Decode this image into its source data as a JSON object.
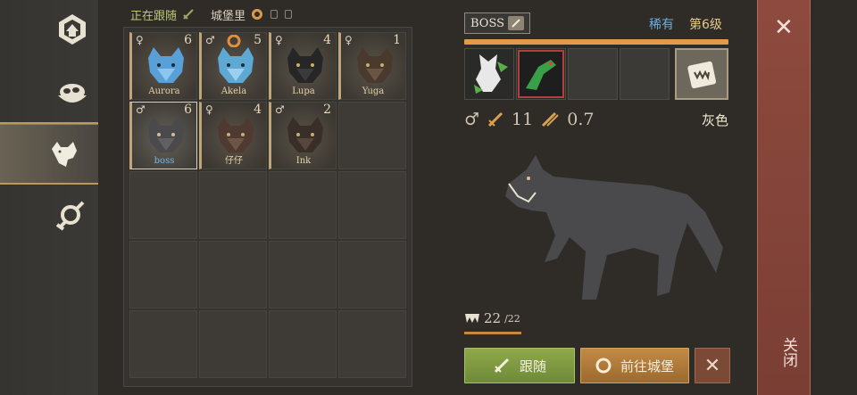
{
  "topbar": {
    "status": "正在跟随",
    "location": "城堡里"
  },
  "wolves": [
    {
      "name": "Aurora",
      "gender": "♀",
      "level": "6",
      "tint": "#5aa0d8"
    },
    {
      "name": "Akela",
      "gender": "♂",
      "level": "5",
      "tint": "#5aa0d8"
    },
    {
      "name": "Lupa",
      "gender": "♀",
      "level": "4",
      "tint": "#2a2a2a"
    },
    {
      "name": "Yuga",
      "gender": "♀",
      "level": "1",
      "tint": "#4a3a2e"
    },
    {
      "name": "boss",
      "gender": "♂",
      "level": "6",
      "tint": "#4a4a4c"
    },
    {
      "name": "仔仔",
      "gender": "♀",
      "level": "4",
      "tint": "#4e3a30"
    },
    {
      "name": "Ink",
      "gender": "♂",
      "level": "2",
      "tint": "#3a2e28"
    }
  ],
  "detail": {
    "name": "BOSS",
    "rarity": "稀有",
    "level": "第6级",
    "gender_symbol": "♂",
    "attack": "11",
    "speed": "0.7",
    "color_name": "灰色",
    "hunger": "22",
    "hunger_max": "/22"
  },
  "buttons": {
    "follow": "跟随",
    "go_castle": "前往城堡",
    "release": "✕"
  },
  "close": {
    "x": "✕",
    "label": "关闭"
  },
  "colors": {
    "rare": "#6aaee0",
    "level": "#e6c98a",
    "xp": "#e39a4a",
    "follow_btn": "#7f9a40",
    "castle_btn": "#b07a3a"
  }
}
